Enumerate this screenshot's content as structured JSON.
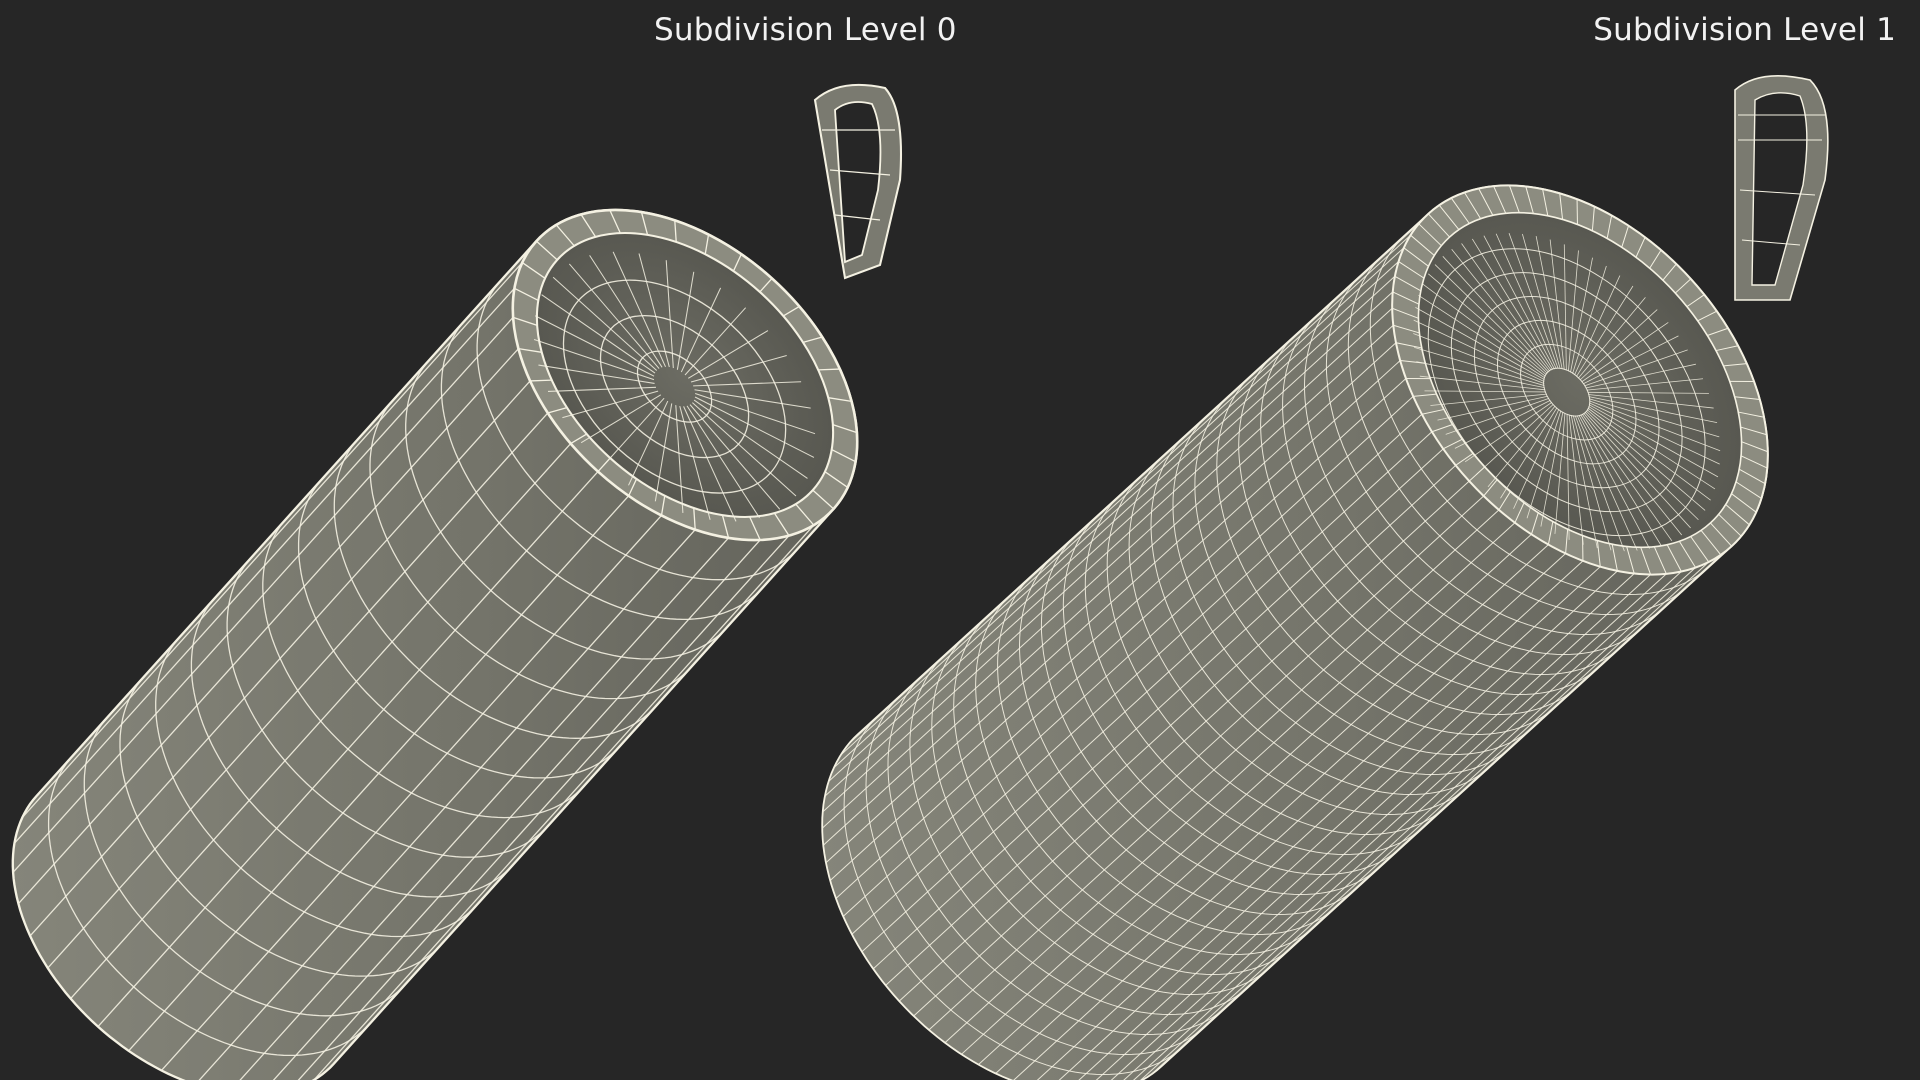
{
  "panels": [
    {
      "label": "Subdivision Level 0",
      "subdivision_level": 0
    },
    {
      "label": "Subdivision Level 1",
      "subdivision_level": 1
    }
  ],
  "colors": {
    "background": "#262626",
    "surface": "#76766c",
    "surface_dark": "#5f5f57",
    "wire": "#f4f1e2",
    "label": "#f2f2f2"
  }
}
